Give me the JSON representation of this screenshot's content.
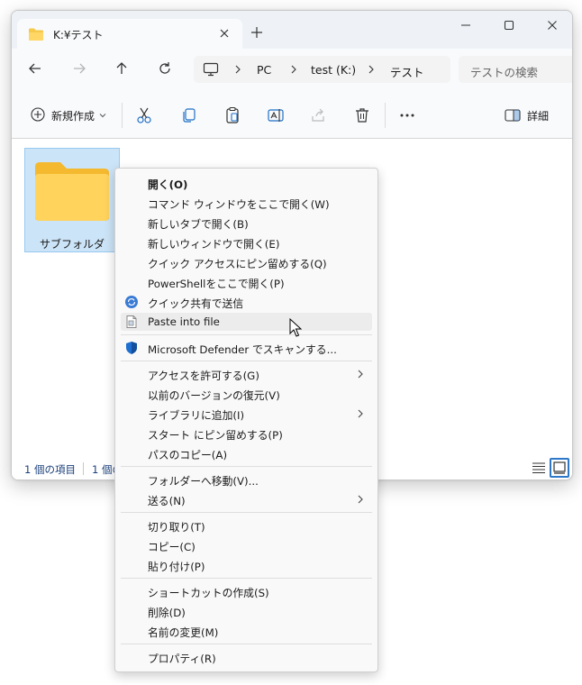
{
  "window": {
    "tab_title": "K:¥テスト",
    "icons": [
      "folder-icon",
      "close-icon",
      "plus-icon",
      "minimize-icon",
      "maximize-icon",
      "close-icon"
    ]
  },
  "address": {
    "crumbs": [
      "PC",
      "test (K:)",
      "テスト"
    ],
    "search_placeholder": "テストの検索",
    "icons": [
      "back-arrow-icon",
      "forward-arrow-icon",
      "up-arrow-icon",
      "refresh-icon",
      "monitor-icon",
      "chevron-right-icon"
    ]
  },
  "toolbar": {
    "new_label": "新規作成",
    "details_label": "詳細",
    "icons": [
      "plus-circle-icon",
      "chevron-down-icon",
      "cut-icon",
      "copy-icon",
      "paste-icon",
      "rename-icon",
      "share-icon",
      "delete-icon",
      "more-icon",
      "details-pane-icon"
    ]
  },
  "content": {
    "folder_label": "サブフォルダ"
  },
  "status": {
    "item_count": "1 個の項目",
    "selected_count": "1 個の",
    "icons": [
      "list-view-icon",
      "tiles-view-icon"
    ]
  },
  "context_menu": {
    "items": [
      {
        "label": "開く(O)"
      },
      {
        "label": "コマンド ウィンドウをここで開く(W)"
      },
      {
        "label": "新しいタブで開く(B)"
      },
      {
        "label": "新しいウィンドウで開く(E)"
      },
      {
        "label": "クイック アクセスにピン留めする(Q)"
      },
      {
        "label": "PowerShellをここで開く(P)"
      },
      {
        "label": "クイック共有で送信",
        "icon": "quick-share-icon"
      },
      {
        "label": "Paste into file",
        "icon": "paste-into-file-icon"
      },
      {
        "label": "Microsoft Defender でスキャンする...",
        "icon": "defender-shield-icon"
      },
      {
        "label": "アクセスを許可する(G)",
        "submenu": true
      },
      {
        "label": "以前のバージョンの復元(V)"
      },
      {
        "label": "ライブラリに追加(I)",
        "submenu": true
      },
      {
        "label": "スタート にピン留めする(P)"
      },
      {
        "label": "パスのコピー(A)"
      },
      {
        "label": "フォルダーへ移動(V)..."
      },
      {
        "label": "送る(N)",
        "submenu": true
      },
      {
        "label": "切り取り(T)"
      },
      {
        "label": "コピー(C)"
      },
      {
        "label": "貼り付け(P)"
      },
      {
        "label": "ショートカットの作成(S)"
      },
      {
        "label": "削除(D)"
      },
      {
        "label": "名前の変更(M)"
      },
      {
        "label": "プロパティ(R)"
      }
    ],
    "hovered": "Paste into file"
  },
  "colors": {
    "accent": "#2d78c8",
    "folder_yellow": "#f6c94a",
    "selection_bg": "#cce4f7",
    "titlebar_bg": "#eef2f7"
  }
}
